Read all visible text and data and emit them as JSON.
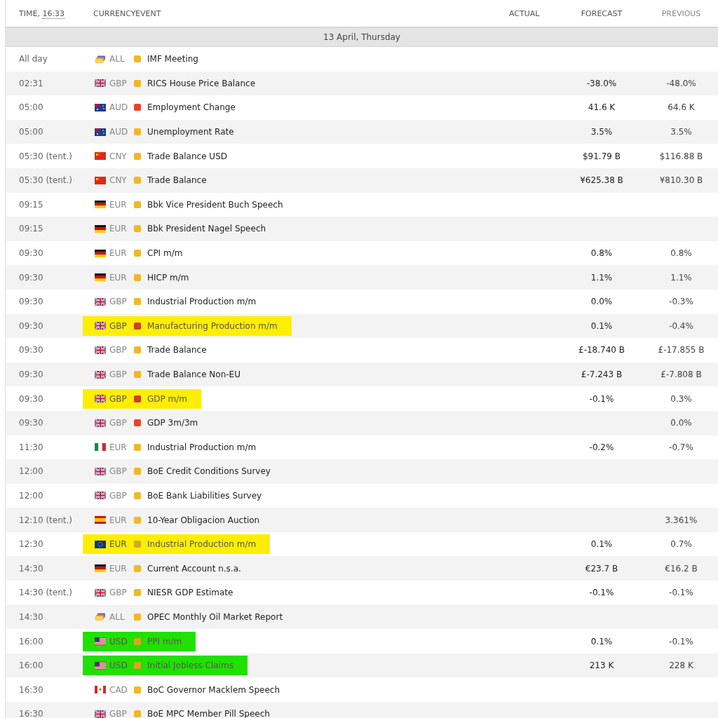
{
  "header": {
    "time_label": "TIME,",
    "clock": "16:33",
    "currency": "CURRENCY",
    "event": "EVENT",
    "actual": "ACTUAL",
    "forecast": "FORECAST",
    "previous": "PREVIOUS"
  },
  "date": "13 April, Thursday",
  "rows": [
    {
      "time": "All day",
      "flag": {
        "kind": "all"
      },
      "currency": "ALL",
      "importance": {
        "kind": "medium"
      },
      "event": "IMF Meeting"
    },
    {
      "time": "02:31",
      "flag": {
        "kind": "gb"
      },
      "currency": "GBP",
      "importance": {
        "kind": "medium"
      },
      "event": "RICS House Price Balance",
      "forecast": "-38.0%",
      "previous": "-48.0%"
    },
    {
      "time": "05:00",
      "flag": {
        "kind": "au"
      },
      "currency": "AUD",
      "importance": {
        "kind": "high"
      },
      "event": "Employment Change",
      "forecast": "41.6 K",
      "previous": "64.6 K"
    },
    {
      "time": "05:00",
      "flag": {
        "kind": "au"
      },
      "currency": "AUD",
      "importance": {
        "kind": "medium"
      },
      "event": "Unemployment Rate",
      "forecast": "3.5%",
      "previous": "3.5%"
    },
    {
      "time": "05:30 (tent.)",
      "flag": {
        "kind": "cn"
      },
      "currency": "CNY",
      "importance": {
        "kind": "medium"
      },
      "event": "Trade Balance USD",
      "forecast": "$91.79 B",
      "previous": "$116.88 B"
    },
    {
      "time": "05:30 (tent.)",
      "flag": {
        "kind": "cn"
      },
      "currency": "CNY",
      "importance": {
        "kind": "medium"
      },
      "event": "Trade Balance",
      "forecast": "¥625.38 B",
      "previous": "¥810.30 B"
    },
    {
      "time": "09:15",
      "flag": {
        "kind": "de"
      },
      "currency": "EUR",
      "importance": {
        "kind": "medium"
      },
      "event": "Bbk Vice President Buch Speech"
    },
    {
      "time": "09:15",
      "flag": {
        "kind": "de"
      },
      "currency": "EUR",
      "importance": {
        "kind": "medium"
      },
      "event": "Bbk President Nagel Speech"
    },
    {
      "time": "09:30",
      "flag": {
        "kind": "de"
      },
      "currency": "EUR",
      "importance": {
        "kind": "medium"
      },
      "event": "CPI m/m",
      "forecast": "0.8%",
      "previous": "0.8%"
    },
    {
      "time": "09:30",
      "flag": {
        "kind": "de"
      },
      "currency": "EUR",
      "importance": {
        "kind": "medium"
      },
      "event": "HICP m/m",
      "forecast": "1.1%",
      "previous": "1.1%"
    },
    {
      "time": "09:30",
      "flag": {
        "kind": "gb"
      },
      "currency": "GBP",
      "importance": {
        "kind": "medium"
      },
      "event": "Industrial Production m/m",
      "forecast": "0.0%",
      "previous": "-0.3%"
    },
    {
      "time": "09:30",
      "flag": {
        "kind": "gb"
      },
      "currency": "GBP",
      "importance": {
        "kind": "high"
      },
      "event": "Manufacturing Production m/m",
      "forecast": "0.1%",
      "previous": "-0.4%",
      "color": "#ffee00"
    },
    {
      "time": "09:30",
      "flag": {
        "kind": "gb"
      },
      "currency": "GBP",
      "importance": {
        "kind": "medium"
      },
      "event": "Trade Balance",
      "forecast": "£-18.740 B",
      "previous": "£-17.855 B"
    },
    {
      "time": "09:30",
      "flag": {
        "kind": "gb"
      },
      "currency": "GBP",
      "importance": {
        "kind": "medium"
      },
      "event": "Trade Balance Non-EU",
      "forecast": "£-7.243 B",
      "previous": "£-7.808 B"
    },
    {
      "time": "09:30",
      "flag": {
        "kind": "gb"
      },
      "currency": "GBP",
      "importance": {
        "kind": "high"
      },
      "event": "GDP m/m",
      "forecast": "-0.1%",
      "previous": "0.3%",
      "color": "#ffee00"
    },
    {
      "time": "09:30",
      "flag": {
        "kind": "gb"
      },
      "currency": "GBP",
      "importance": {
        "kind": "high"
      },
      "event": "GDP 3m/3m",
      "previous": "0.0%"
    },
    {
      "time": "11:30",
      "flag": {
        "kind": "it"
      },
      "currency": "EUR",
      "importance": {
        "kind": "medium"
      },
      "event": "Industrial Production m/m",
      "forecast": "-0.2%",
      "previous": "-0.7%"
    },
    {
      "time": "12:00",
      "flag": {
        "kind": "gb"
      },
      "currency": "GBP",
      "importance": {
        "kind": "medium"
      },
      "event": "BoE Credit Conditions Survey"
    },
    {
      "time": "12:00",
      "flag": {
        "kind": "gb"
      },
      "currency": "GBP",
      "importance": {
        "kind": "medium"
      },
      "event": "BoE Bank Liabilities Survey"
    },
    {
      "time": "12:10 (tent.)",
      "flag": {
        "kind": "es"
      },
      "currency": "EUR",
      "importance": {
        "kind": "medium"
      },
      "event": "10-Year Obligacion Auction",
      "previous": "3.361%"
    },
    {
      "time": "12:30",
      "flag": {
        "kind": "eu"
      },
      "currency": "EUR",
      "importance": {
        "kind": "medium"
      },
      "event": "Industrial Production m/m",
      "forecast": "0.1%",
      "previous": "0.7%",
      "color": "#ffee00"
    },
    {
      "time": "14:30",
      "flag": {
        "kind": "de"
      },
      "currency": "EUR",
      "importance": {
        "kind": "medium"
      },
      "event": "Current Account n.s.a.",
      "forecast": "€23.7 B",
      "previous": "€16.2 B"
    },
    {
      "time": "14:30 (tent.)",
      "flag": {
        "kind": "gb"
      },
      "currency": "GBP",
      "importance": {
        "kind": "medium"
      },
      "event": "NIESR GDP Estimate",
      "forecast": "-0.1%",
      "previous": "-0.1%"
    },
    {
      "time": "14:30",
      "flag": {
        "kind": "all"
      },
      "currency": "ALL",
      "importance": {
        "kind": "medium"
      },
      "event": "OPEC Monthly Oil Market Report"
    },
    {
      "time": "16:00",
      "flag": {
        "kind": "us"
      },
      "currency": "USD",
      "importance": {
        "kind": "medium"
      },
      "event": "PPI m/m",
      "forecast": "0.1%",
      "previous": "-0.1%",
      "color": "#22e000"
    },
    {
      "time": "16:00",
      "flag": {
        "kind": "us"
      },
      "currency": "USD",
      "importance": {
        "kind": "medium"
      },
      "event": "Initial Jobless Claims",
      "forecast": "213 K",
      "previous": "228 K",
      "color": "#22e000"
    },
    {
      "time": "16:30",
      "flag": {
        "kind": "ca"
      },
      "currency": "CAD",
      "importance": {
        "kind": "medium"
      },
      "event": "BoC Governor Macklem Speech"
    },
    {
      "time": "16:30",
      "flag": {
        "kind": "gb"
      },
      "currency": "GBP",
      "importance": {
        "kind": "medium"
      },
      "event": "BoE MPC Member Pill Speech"
    }
  ]
}
